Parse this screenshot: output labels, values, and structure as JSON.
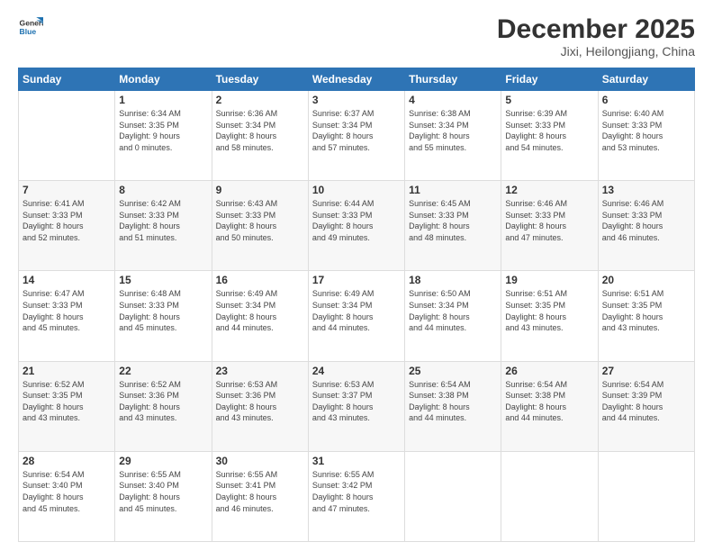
{
  "logo": {
    "line1": "General",
    "line2": "Blue"
  },
  "title": "December 2025",
  "subtitle": "Jixi, Heilongjiang, China",
  "days_of_week": [
    "Sunday",
    "Monday",
    "Tuesday",
    "Wednesday",
    "Thursday",
    "Friday",
    "Saturday"
  ],
  "weeks": [
    [
      {
        "num": "",
        "info": ""
      },
      {
        "num": "1",
        "info": "Sunrise: 6:34 AM\nSunset: 3:35 PM\nDaylight: 9 hours\nand 0 minutes."
      },
      {
        "num": "2",
        "info": "Sunrise: 6:36 AM\nSunset: 3:34 PM\nDaylight: 8 hours\nand 58 minutes."
      },
      {
        "num": "3",
        "info": "Sunrise: 6:37 AM\nSunset: 3:34 PM\nDaylight: 8 hours\nand 57 minutes."
      },
      {
        "num": "4",
        "info": "Sunrise: 6:38 AM\nSunset: 3:34 PM\nDaylight: 8 hours\nand 55 minutes."
      },
      {
        "num": "5",
        "info": "Sunrise: 6:39 AM\nSunset: 3:33 PM\nDaylight: 8 hours\nand 54 minutes."
      },
      {
        "num": "6",
        "info": "Sunrise: 6:40 AM\nSunset: 3:33 PM\nDaylight: 8 hours\nand 53 minutes."
      }
    ],
    [
      {
        "num": "7",
        "info": "Sunrise: 6:41 AM\nSunset: 3:33 PM\nDaylight: 8 hours\nand 52 minutes."
      },
      {
        "num": "8",
        "info": "Sunrise: 6:42 AM\nSunset: 3:33 PM\nDaylight: 8 hours\nand 51 minutes."
      },
      {
        "num": "9",
        "info": "Sunrise: 6:43 AM\nSunset: 3:33 PM\nDaylight: 8 hours\nand 50 minutes."
      },
      {
        "num": "10",
        "info": "Sunrise: 6:44 AM\nSunset: 3:33 PM\nDaylight: 8 hours\nand 49 minutes."
      },
      {
        "num": "11",
        "info": "Sunrise: 6:45 AM\nSunset: 3:33 PM\nDaylight: 8 hours\nand 48 minutes."
      },
      {
        "num": "12",
        "info": "Sunrise: 6:46 AM\nSunset: 3:33 PM\nDaylight: 8 hours\nand 47 minutes."
      },
      {
        "num": "13",
        "info": "Sunrise: 6:46 AM\nSunset: 3:33 PM\nDaylight: 8 hours\nand 46 minutes."
      }
    ],
    [
      {
        "num": "14",
        "info": "Sunrise: 6:47 AM\nSunset: 3:33 PM\nDaylight: 8 hours\nand 45 minutes."
      },
      {
        "num": "15",
        "info": "Sunrise: 6:48 AM\nSunset: 3:33 PM\nDaylight: 8 hours\nand 45 minutes."
      },
      {
        "num": "16",
        "info": "Sunrise: 6:49 AM\nSunset: 3:34 PM\nDaylight: 8 hours\nand 44 minutes."
      },
      {
        "num": "17",
        "info": "Sunrise: 6:49 AM\nSunset: 3:34 PM\nDaylight: 8 hours\nand 44 minutes."
      },
      {
        "num": "18",
        "info": "Sunrise: 6:50 AM\nSunset: 3:34 PM\nDaylight: 8 hours\nand 44 minutes."
      },
      {
        "num": "19",
        "info": "Sunrise: 6:51 AM\nSunset: 3:35 PM\nDaylight: 8 hours\nand 43 minutes."
      },
      {
        "num": "20",
        "info": "Sunrise: 6:51 AM\nSunset: 3:35 PM\nDaylight: 8 hours\nand 43 minutes."
      }
    ],
    [
      {
        "num": "21",
        "info": "Sunrise: 6:52 AM\nSunset: 3:35 PM\nDaylight: 8 hours\nand 43 minutes."
      },
      {
        "num": "22",
        "info": "Sunrise: 6:52 AM\nSunset: 3:36 PM\nDaylight: 8 hours\nand 43 minutes."
      },
      {
        "num": "23",
        "info": "Sunrise: 6:53 AM\nSunset: 3:36 PM\nDaylight: 8 hours\nand 43 minutes."
      },
      {
        "num": "24",
        "info": "Sunrise: 6:53 AM\nSunset: 3:37 PM\nDaylight: 8 hours\nand 43 minutes."
      },
      {
        "num": "25",
        "info": "Sunrise: 6:54 AM\nSunset: 3:38 PM\nDaylight: 8 hours\nand 44 minutes."
      },
      {
        "num": "26",
        "info": "Sunrise: 6:54 AM\nSunset: 3:38 PM\nDaylight: 8 hours\nand 44 minutes."
      },
      {
        "num": "27",
        "info": "Sunrise: 6:54 AM\nSunset: 3:39 PM\nDaylight: 8 hours\nand 44 minutes."
      }
    ],
    [
      {
        "num": "28",
        "info": "Sunrise: 6:54 AM\nSunset: 3:40 PM\nDaylight: 8 hours\nand 45 minutes."
      },
      {
        "num": "29",
        "info": "Sunrise: 6:55 AM\nSunset: 3:40 PM\nDaylight: 8 hours\nand 45 minutes."
      },
      {
        "num": "30",
        "info": "Sunrise: 6:55 AM\nSunset: 3:41 PM\nDaylight: 8 hours\nand 46 minutes."
      },
      {
        "num": "31",
        "info": "Sunrise: 6:55 AM\nSunset: 3:42 PM\nDaylight: 8 hours\nand 47 minutes."
      },
      {
        "num": "",
        "info": ""
      },
      {
        "num": "",
        "info": ""
      },
      {
        "num": "",
        "info": ""
      }
    ]
  ]
}
